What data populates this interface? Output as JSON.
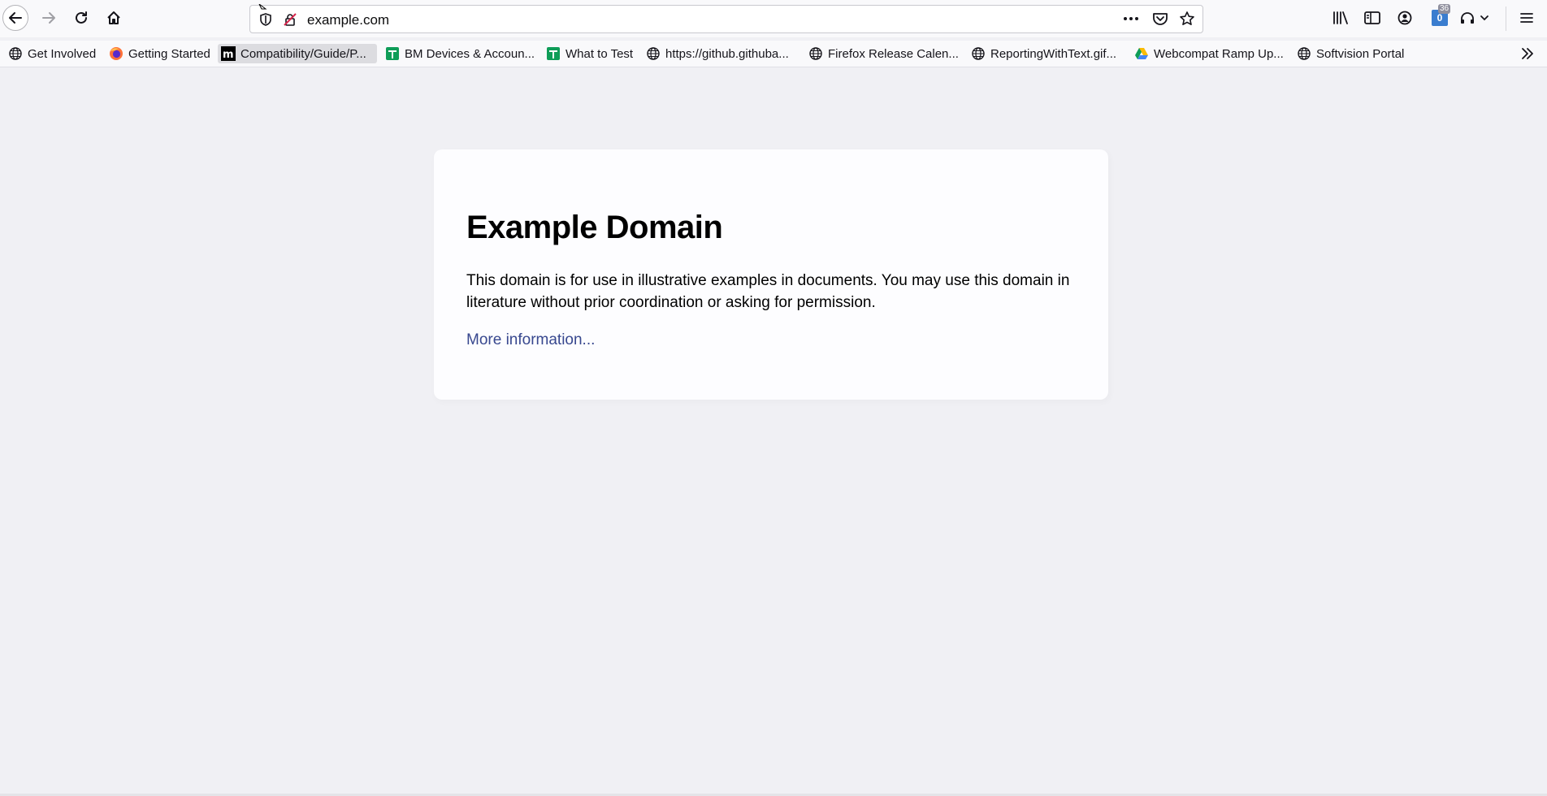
{
  "address_bar": {
    "url": "example.com"
  },
  "toolbar": {
    "notification_badge": "0",
    "notification_count": "36"
  },
  "bookmarks": [
    {
      "label": "Get Involved",
      "icon": "globe-icon"
    },
    {
      "label": "Getting Started",
      "icon": "firefox-icon"
    },
    {
      "label": "Compatibility/Guide/P...",
      "icon": "mdn-icon"
    },
    {
      "label": "BM Devices & Accoun...",
      "icon": "sheets-icon"
    },
    {
      "label": "What to Test",
      "icon": "sheets-icon"
    },
    {
      "label": "https://github.githuba...",
      "icon": "globe-icon"
    },
    {
      "label": "Firefox Release Calen...",
      "icon": "globe-icon"
    },
    {
      "label": "ReportingWithText.gif...",
      "icon": "globe-icon"
    },
    {
      "label": "Webcompat Ramp Up...",
      "icon": "drive-icon"
    },
    {
      "label": "Softvision Portal",
      "icon": "globe-icon"
    }
  ],
  "page": {
    "heading": "Example Domain",
    "paragraph": "This domain is for use in illustrative examples in documents. You may use this domain in literature without prior coordination or asking for permission.",
    "link_text": "More information..."
  },
  "colors": {
    "page_background": "#f0f0f4",
    "card_background": "#fdfdff",
    "link": "#38488f",
    "badge": "#3a7dcf"
  }
}
